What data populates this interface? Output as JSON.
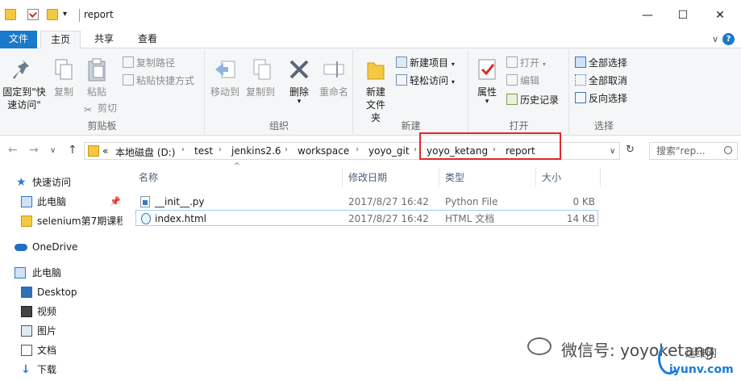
{
  "window": {
    "title": "report",
    "minimize": "—",
    "maximize": "☐",
    "close": "✕"
  },
  "tabs": {
    "file": "文件",
    "home": "主页",
    "share": "共享",
    "view": "查看"
  },
  "ribbon_toggle": "∨",
  "help": "?",
  "ribbon": {
    "clipboard": {
      "label": "剪贴板",
      "pin_quick_access": "固定到\"快速访问\"",
      "copy": "复制",
      "paste": "粘贴",
      "copy_path": "复制路径",
      "paste_shortcut": "粘贴快捷方式",
      "cut": "剪切"
    },
    "organize": {
      "label": "组织",
      "move_to": "移动到",
      "copy_to": "复制到",
      "delete": "删除",
      "rename": "重命名"
    },
    "new": {
      "label": "新建",
      "new_folder": "新建文件夹",
      "new_item": "新建项目",
      "easy_access": "轻松访问"
    },
    "open": {
      "label": "打开",
      "properties": "属性",
      "open": "打开",
      "edit": "编辑",
      "history": "历史记录"
    },
    "select": {
      "label": "选择",
      "select_all": "全部选择",
      "select_none": "全部取消",
      "invert": "反向选择"
    }
  },
  "address": {
    "back": "←",
    "forward": "→",
    "recent": "∨",
    "up": "↑",
    "overflow": "«",
    "crumbs": [
      "本地磁盘 (D:)",
      "test",
      "jenkins2.6",
      "workspace",
      "yoyo_git",
      "yoyo_ketang",
      "report"
    ],
    "dropdown": "∨",
    "refresh": "↻",
    "search_placeholder": "搜索\"rep..."
  },
  "nav": {
    "quick_access": "快速访问",
    "this_pc_pinned": "此电脑",
    "selenium": "selenium第7期课程",
    "onedrive": "OneDrive",
    "this_pc": "此电脑",
    "desktop": "Desktop",
    "videos": "视频",
    "pictures": "图片",
    "documents": "文档",
    "downloads": "下载"
  },
  "columns": {
    "name": "名称",
    "modified": "修改日期",
    "type": "类型",
    "size": "大小",
    "sort_indicator": "^"
  },
  "files": [
    {
      "name": "__init__.py",
      "modified": "2017/8/27 16:42",
      "type": "Python File",
      "size": "0 KB"
    },
    {
      "name": "index.html",
      "modified": "2017/8/27 16:42",
      "type": "HTML 文档",
      "size": "14 KB"
    }
  ],
  "watermark": {
    "text": "微信号: yoyoketang",
    "site_name": "运维网",
    "site_url": "iyunv.com"
  },
  "colors": {
    "file_tab": "#1979ca",
    "highlight": "#e0282c",
    "selection_border": "#99d1ff",
    "folder": "#f5c842"
  }
}
